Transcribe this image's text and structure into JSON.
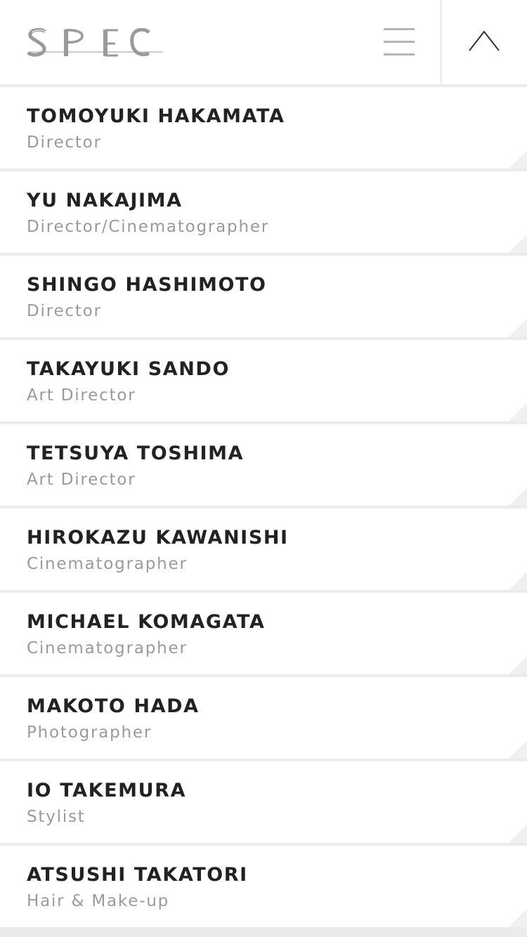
{
  "header": {
    "logo_text": "SPEC",
    "logo_color": "#9a9a9a",
    "menu_icon": "hamburger-menu-icon",
    "scroll_top_icon": "chevron-up-icon"
  },
  "staff": [
    {
      "name": "TOMOYUKI HAKAMATA",
      "role": "Director"
    },
    {
      "name": "YU NAKAJIMA",
      "role": "Director/Cinematographer"
    },
    {
      "name": "SHINGO HASHIMOTO",
      "role": "Director"
    },
    {
      "name": "TAKAYUKI SANDO",
      "role": "Art Director"
    },
    {
      "name": "TETSUYA TOSHIMA",
      "role": "Art Director"
    },
    {
      "name": "HIROKAZU KAWANISHI",
      "role": "Cinematographer"
    },
    {
      "name": "MICHAEL KOMAGATA",
      "role": "Cinematographer"
    },
    {
      "name": "MAKOTO HADA",
      "role": "Photographer"
    },
    {
      "name": "IO TAKEMURA",
      "role": "Stylist"
    },
    {
      "name": "ATSUSHI TAKATORI",
      "role": "Hair & Make-up"
    }
  ]
}
